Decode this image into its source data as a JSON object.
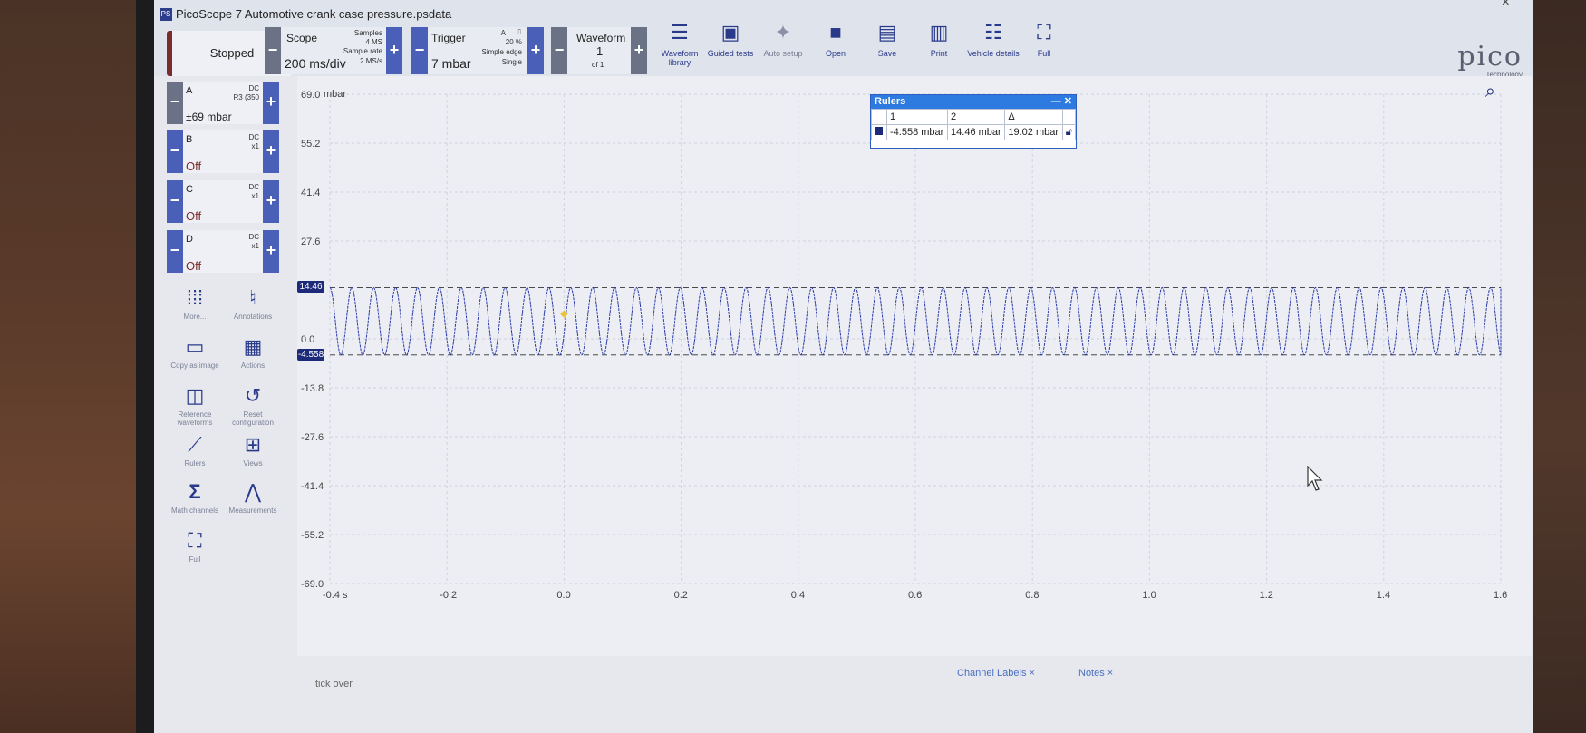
{
  "window": {
    "title": "PicoScope 7 Automotive crank case pressure.psdata",
    "logo": "PS",
    "close": "×"
  },
  "toolbar": {
    "run_state": "Stopped",
    "scope": {
      "label": "Scope",
      "value": "200 ms/div",
      "samples_label": "Samples",
      "samples": "4 MS",
      "rate_label": "Sample rate",
      "rate": "2 MS/s"
    },
    "trigger": {
      "label": "Trigger",
      "value": "7 mbar",
      "channel": "A",
      "edge_symbol": "⎍",
      "percent": "20 %",
      "type": "Simple edge",
      "mode": "Single"
    },
    "waveform": {
      "label": "Waveform",
      "value": "1",
      "of": "of 1"
    },
    "buttons": [
      {
        "label": "Waveform library",
        "icon": "book-stack-icon"
      },
      {
        "label": "Guided tests",
        "icon": "car-icon"
      },
      {
        "label": "Auto setup",
        "icon": "magic-wand-icon"
      },
      {
        "label": "Open",
        "icon": "folder-icon"
      },
      {
        "label": "Save",
        "icon": "floppy-disk-icon"
      },
      {
        "label": "Print",
        "icon": "printer-icon"
      },
      {
        "label": "Vehicle details",
        "icon": "clipboard-icon"
      },
      {
        "label": "Full",
        "icon": "fullscreen-icon"
      }
    ],
    "brand": "pico",
    "brand_sub": "Technology"
  },
  "channels": [
    {
      "name": "A",
      "coupling": "DC",
      "probe": "R3 (350",
      "range": "±69 mbar"
    },
    {
      "name": "B",
      "coupling": "DC",
      "probe": "x1",
      "range": "Off"
    },
    {
      "name": "C",
      "coupling": "DC",
      "probe": "x1",
      "range": "Off"
    },
    {
      "name": "D",
      "coupling": "DC",
      "probe": "x1",
      "range": "Off"
    }
  ],
  "tools": [
    {
      "label": "More...",
      "icon": "grid-dots-icon"
    },
    {
      "label": "Annotations",
      "icon": "annotation-icon"
    },
    {
      "label": "Copy as image",
      "icon": "image-icon"
    },
    {
      "label": "Actions",
      "icon": "clapperboard-icon"
    },
    {
      "label": "Reference waveforms",
      "icon": "reference-waveform-icon"
    },
    {
      "label": "Reset configuration",
      "icon": "reset-icon"
    },
    {
      "label": "Rulers",
      "icon": "ruler-icon"
    },
    {
      "label": "Views",
      "icon": "views-grid-icon"
    },
    {
      "label": "Math channels",
      "icon": "sigma-icon"
    },
    {
      "label": "Measurements",
      "icon": "compass-icon"
    },
    {
      "label": "Full",
      "icon": "fullscreen-icon"
    }
  ],
  "rulers": {
    "title": "Rulers",
    "headers": [
      "1",
      "2",
      "Δ"
    ],
    "values": [
      "-4.558 mbar",
      "14.46 mbar",
      "19.02 mbar"
    ]
  },
  "plot": {
    "y_unit": "mbar",
    "y_ticks": [
      "69.0",
      "55.2",
      "41.4",
      "27.6",
      "0.0",
      "-13.8",
      "-27.6",
      "-41.4",
      "-55.2",
      "-69.0"
    ],
    "x_ticks": [
      "-0.4 s",
      "-0.2",
      "0.0",
      "0.2",
      "0.4",
      "0.6",
      "0.8",
      "1.0",
      "1.2",
      "1.4",
      "1.6"
    ],
    "ruler_markers": [
      "14.46",
      "-4.558"
    ]
  },
  "chart_data": {
    "type": "line",
    "title": "",
    "xlabel": "",
    "ylabel": "mbar",
    "xlim": [
      -0.4,
      1.6
    ],
    "ylim": [
      -69.0,
      69.0
    ],
    "x_unit": "s",
    "series": [
      {
        "signal": "sine",
        "max": 14.46,
        "min": -4.558,
        "cycles": 54,
        "x_start": -0.4,
        "x_end": 1.62,
        "color": "#2a3aa8"
      }
    ],
    "rulers_y": [
      14.46,
      -4.558
    ],
    "trigger_point": {
      "x": 0.0,
      "y": 7
    },
    "grid": true
  },
  "bottom": {
    "tabs": [
      "Channel Labels ×",
      "Notes ×"
    ],
    "footer": "tick over"
  }
}
